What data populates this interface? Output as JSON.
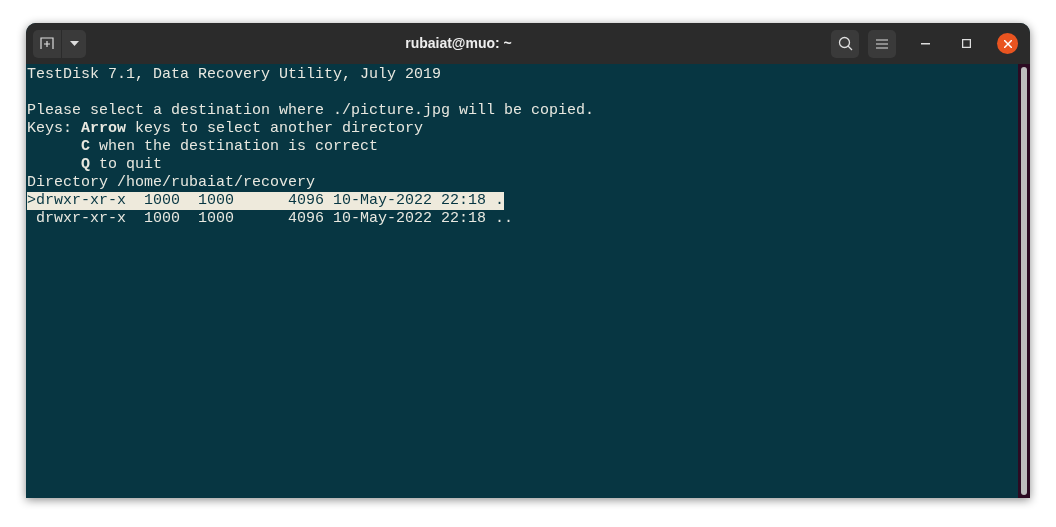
{
  "window": {
    "title": "rubaiat@muo: ~"
  },
  "terminal": {
    "header": "TestDisk 7.1, Data Recovery Utility, July 2019",
    "prompt_lines": [
      "Please select a destination where ./picture.jpg will be copied.",
      "Keys: **Arrow** keys to select another directory",
      "      **C** when the destination is correct",
      "      **Q** to quit",
      "Directory /home/rubaiat/recovery"
    ],
    "entries": [
      {
        "text": ">drwxr-xr-x  1000  1000      4096 10-May-2022 22:18 .",
        "selected": true
      },
      {
        "text": " drwxr-xr-x  1000  1000      4096 10-May-2022 22:18 ..",
        "selected": false
      }
    ]
  }
}
